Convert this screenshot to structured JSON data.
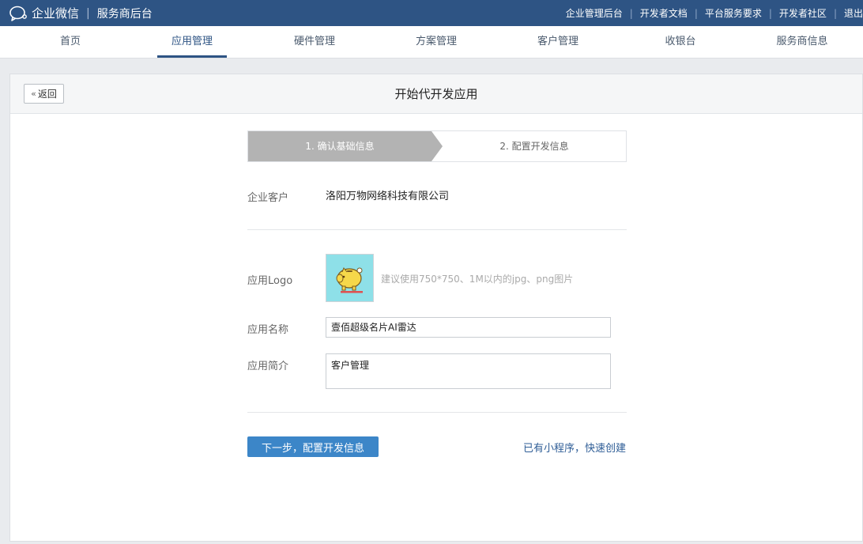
{
  "topbar": {
    "brand_name": "企业微信",
    "separator": "|",
    "sub_title": "服务商后台",
    "links": [
      "企业管理后台",
      "开发者文档",
      "平台服务要求",
      "开发者社区",
      "退出"
    ]
  },
  "nav": {
    "items": [
      "首页",
      "应用管理",
      "硬件管理",
      "方案管理",
      "客户管理",
      "收银台",
      "服务商信息"
    ],
    "active": "应用管理"
  },
  "page": {
    "back_label": "返回",
    "title": "开始代开发应用"
  },
  "steps": {
    "step1": "1. 确认基础信息",
    "step2": "2. 配置开发信息",
    "active_step": 1
  },
  "form": {
    "customer_label": "企业客户",
    "customer_value": "洛阳万物网络科技有限公司",
    "logo_label": "应用Logo",
    "logo_hint": "建议使用750*750、1M以内的jpg、png图片",
    "logo_icon": "piggy-bank-icon",
    "name_label": "应用名称",
    "name_value": "壹佰超级名片AI雷达",
    "desc_label": "应用简介",
    "desc_value": "客户管理"
  },
  "actions": {
    "next_label": "下一步，配置开发信息",
    "quick_link": "已有小程序，快速创建"
  },
  "colors": {
    "topbar": "#2e5484",
    "primary_button": "#3c86c8",
    "step_active": "#b3b3b3",
    "logo_bg": "#8ee0e8"
  }
}
